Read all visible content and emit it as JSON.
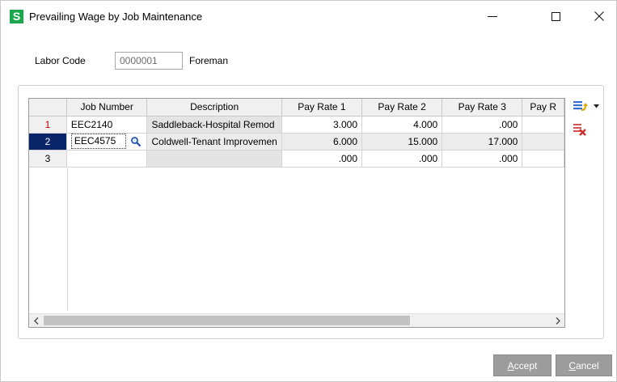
{
  "window": {
    "title": "Prevailing Wage by Job Maintenance",
    "app_icon_letter": "S",
    "close_glyph": "✕"
  },
  "labor": {
    "label": "Labor Code",
    "code_value": "0000001",
    "description": "Foreman"
  },
  "grid": {
    "columns": [
      "",
      "Job Number",
      "Description",
      "Pay Rate 1",
      "Pay Rate 2",
      "Pay Rate 3",
      "Pay R"
    ],
    "rows": [
      {
        "num": "1",
        "job": "EEC2140",
        "description": "Saddleback-Hospital Remod",
        "rate1": "3.000",
        "rate2": "4.000",
        "rate3": ".000",
        "rate4": ""
      },
      {
        "num": "2",
        "job": "EEC4575",
        "description": "Coldwell-Tenant Improvemen",
        "rate1": "6.000",
        "rate2": "15.000",
        "rate3": "17.000",
        "rate4": ""
      },
      {
        "num": "3",
        "job": "",
        "description": "",
        "rate1": ".000",
        "rate2": ".000",
        "rate3": ".000",
        "rate4": ""
      }
    ],
    "selected_row": 2
  },
  "scrollbar": {
    "left_arrow": "<",
    "right_arrow": ">"
  },
  "buttons": {
    "accept_hotkey": "A",
    "accept_rest": "ccept",
    "cancel_hotkey": "C",
    "cancel_rest": "ancel"
  },
  "icons": {
    "customize": "customize-columns-icon",
    "delete": "delete-row-icon",
    "lookup": "magnifier-lookup-icon"
  }
}
